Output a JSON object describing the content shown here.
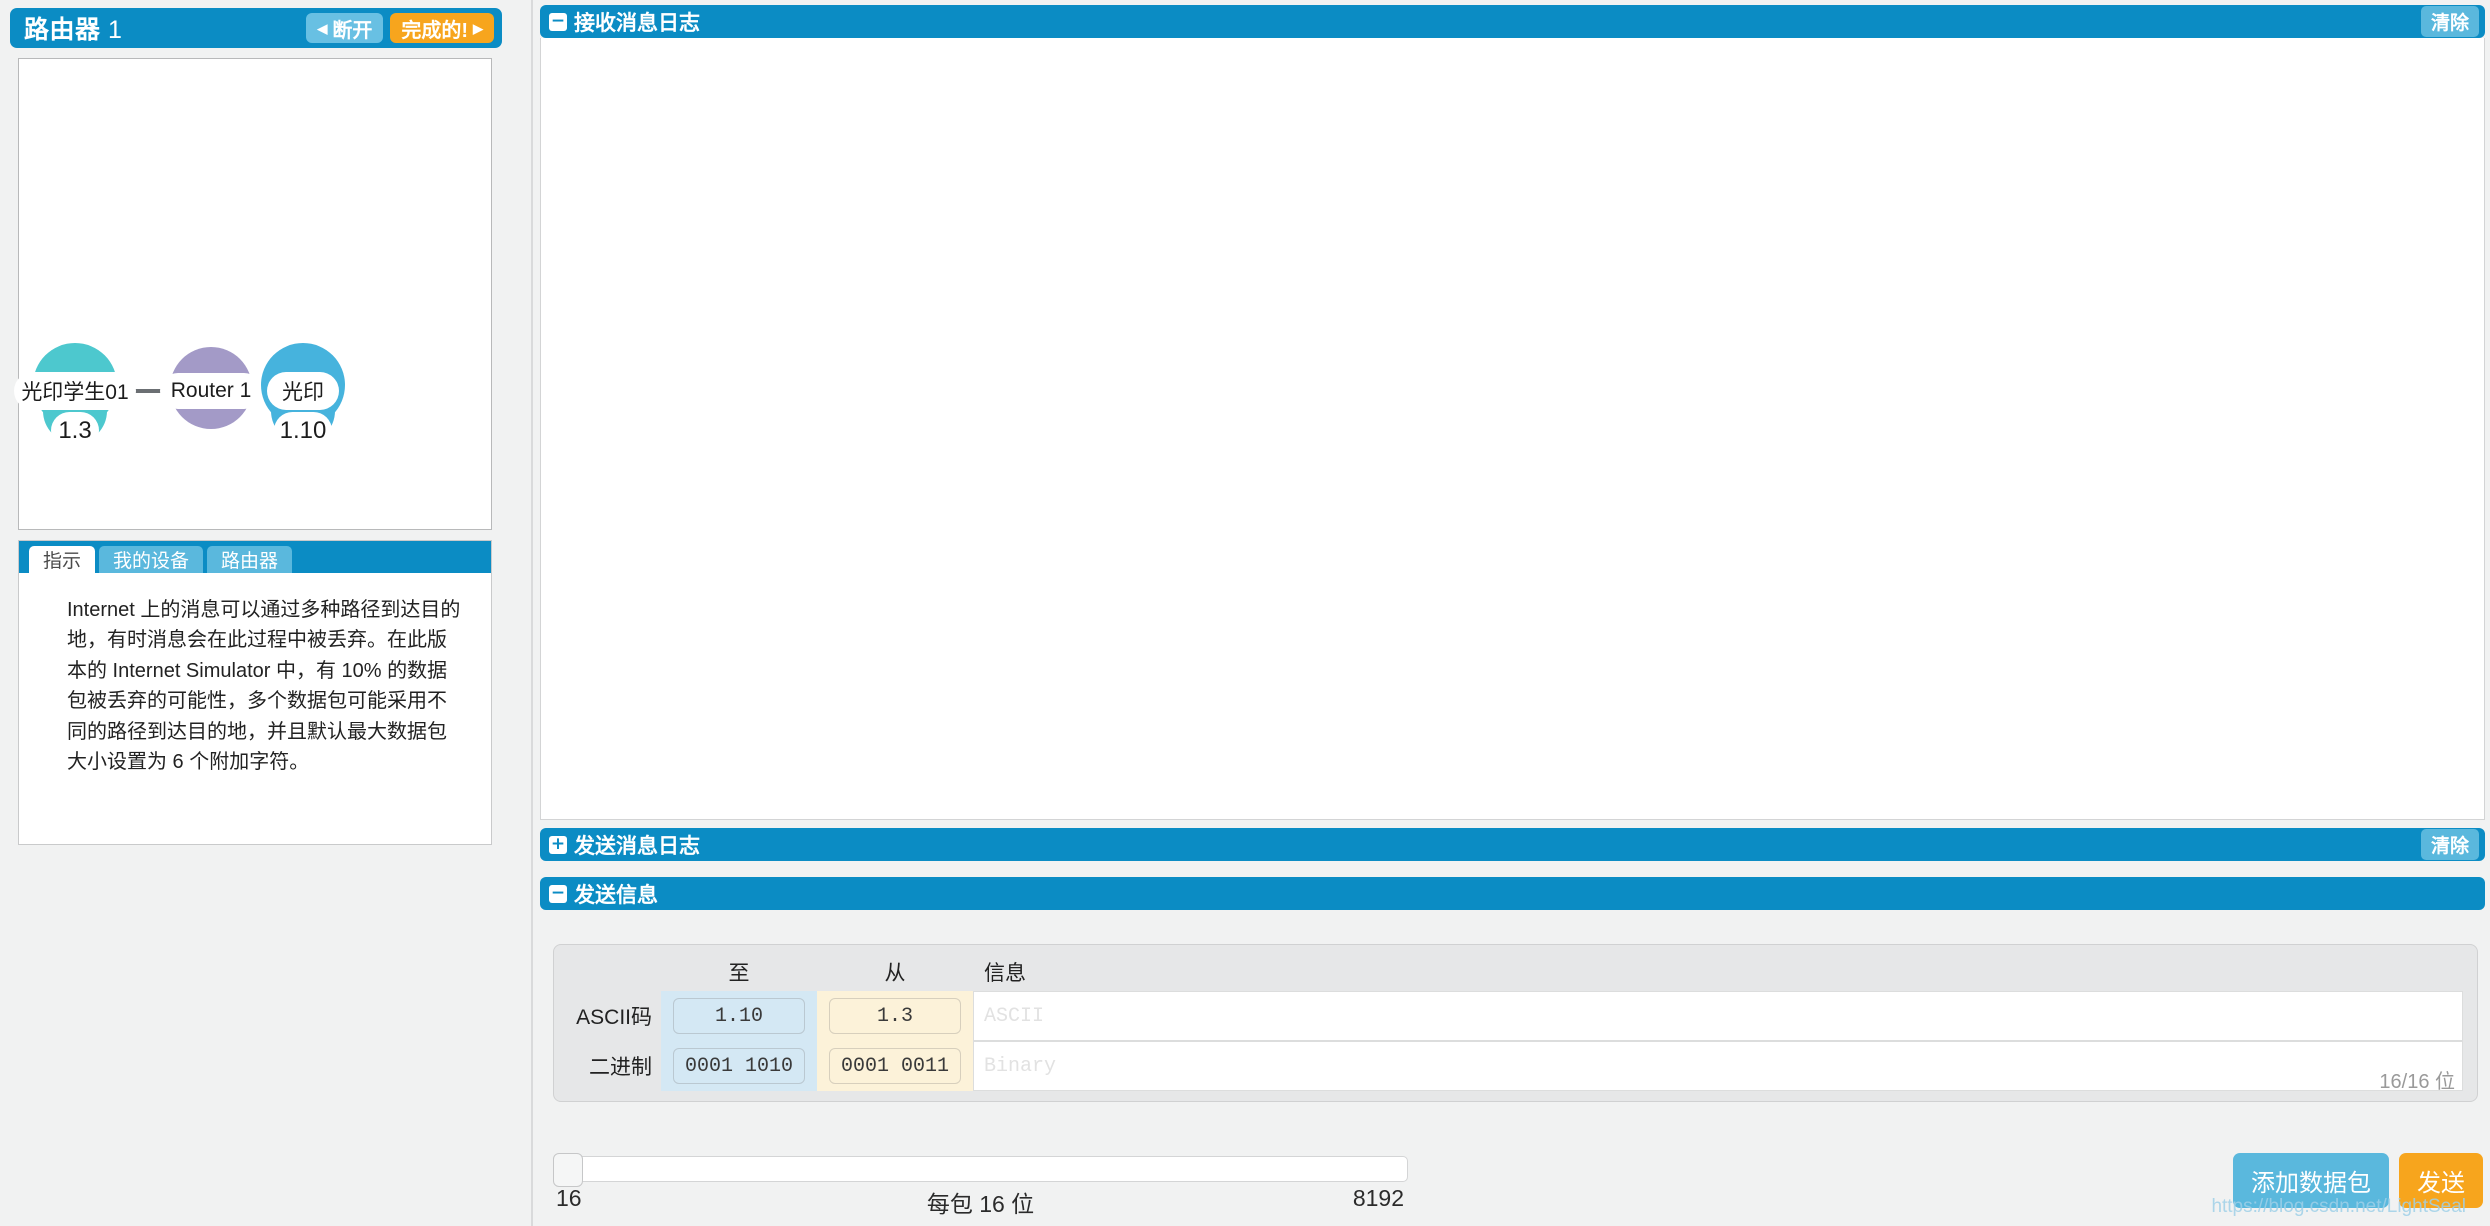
{
  "left_panel": {
    "title_label": "路由器",
    "title_number": "1",
    "prev_button": "断开",
    "next_button": "完成的!",
    "prev_arrow": "◀",
    "next_arrow": "▶",
    "diagram": {
      "nodes": [
        {
          "name": "光印学生01",
          "address": "1.3",
          "color": "#4dc8ce",
          "kind": "device"
        },
        {
          "name": "Router 1",
          "address": "",
          "color": "#a39ac7",
          "kind": "router"
        },
        {
          "name": "光印",
          "address": "1.10",
          "color": "#46b3dd",
          "kind": "device"
        }
      ]
    },
    "tabs": [
      {
        "label": "指示",
        "active": true
      },
      {
        "label": "我的设备",
        "active": false
      },
      {
        "label": "路由器",
        "active": false
      }
    ],
    "instructions": "Internet 上的消息可以通过多种路径到达目的地，有时消息会在此过程中被丢弃。在此版本的 Internet Simulator 中，有 10% 的数据包被丢弃的可能性，多个数据包可能采用不同的路径到达目的地，并且默认最大数据包大小设置为 6 个附加字符。"
  },
  "receive_log": {
    "toggle_icon": "−",
    "title": "接收消息日志",
    "clear_button": "清除",
    "content": ""
  },
  "send_log": {
    "toggle_icon": "+",
    "title": "发送消息日志",
    "clear_button": "清除"
  },
  "send_message": {
    "toggle_icon": "−",
    "title": "发送信息",
    "columns": {
      "to": "至",
      "from": "从",
      "message": "信息"
    },
    "rows": [
      {
        "row_label": "ASCII码",
        "to_value": "1.10",
        "from_value": "1.3",
        "message_value": "",
        "message_placeholder": "ASCII"
      },
      {
        "row_label": "二进制",
        "to_value": "0001 1010",
        "from_value": "0001 0011",
        "message_value": "",
        "message_placeholder": "Binary"
      }
    ],
    "bit_counter": "16/16 位",
    "slider": {
      "min_label": "16",
      "mid_label": "每包 16 位",
      "max_label": "8192",
      "value": 16
    },
    "add_packet_button": "添加数据包",
    "send_button": "发送"
  },
  "watermark": "https://blog.csdn.net/LightSeal",
  "colors": {
    "header_blue": "#0b8cc4",
    "accent_orange": "#f7a51d",
    "accent_light_blue": "#5ab8dd",
    "to_cell": "#d4e8f4",
    "from_cell": "#fcf2d9",
    "page_bg": "#f1f2f2"
  }
}
